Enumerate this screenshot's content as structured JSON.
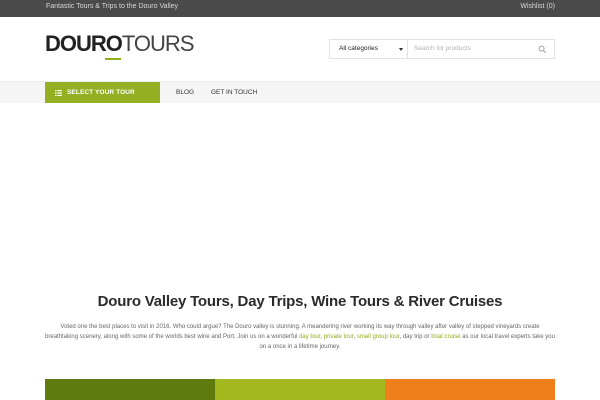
{
  "topbar": {
    "tagline": "Fantastic Tours & Trips to the Douro Valley",
    "wishlist": "Wishlist (0)"
  },
  "logo": {
    "bold": "DOURO",
    "light": "TOURS"
  },
  "search": {
    "category": "All categories",
    "placeholder": "Search for products",
    "value": ""
  },
  "nav": {
    "select_tour": "SELECT YOUR TOUR",
    "items": [
      "BLOG",
      "GET IN TOUCH"
    ]
  },
  "main": {
    "headline": "Douro Valley Tours, Day Trips, Wine Tours & River Cruises",
    "intro": {
      "p1": "Voted one the best places to visit in 2016. Who could argue? The Douro valley is stunning. A meandering river working its way through valley after valley of stepped vineyards create breathtaking scenery, along with some of the worlds best wine and Port. Join us on a wonderful ",
      "link1": "day tour",
      "s1": ", ",
      "link2": "private tour",
      "s2": ", ",
      "link3": "small group tour",
      "s3": ", day trip or ",
      "link4": "boat cruise",
      "p2": " as our local travel experts take you on a once in a lifetime journey."
    }
  },
  "colors": {
    "accent": "#94b022",
    "block_dark_green": "#5f7b0f",
    "block_light_green": "#a3b71f",
    "block_orange": "#ef7f1a",
    "topbar": "#4a4a4a"
  }
}
